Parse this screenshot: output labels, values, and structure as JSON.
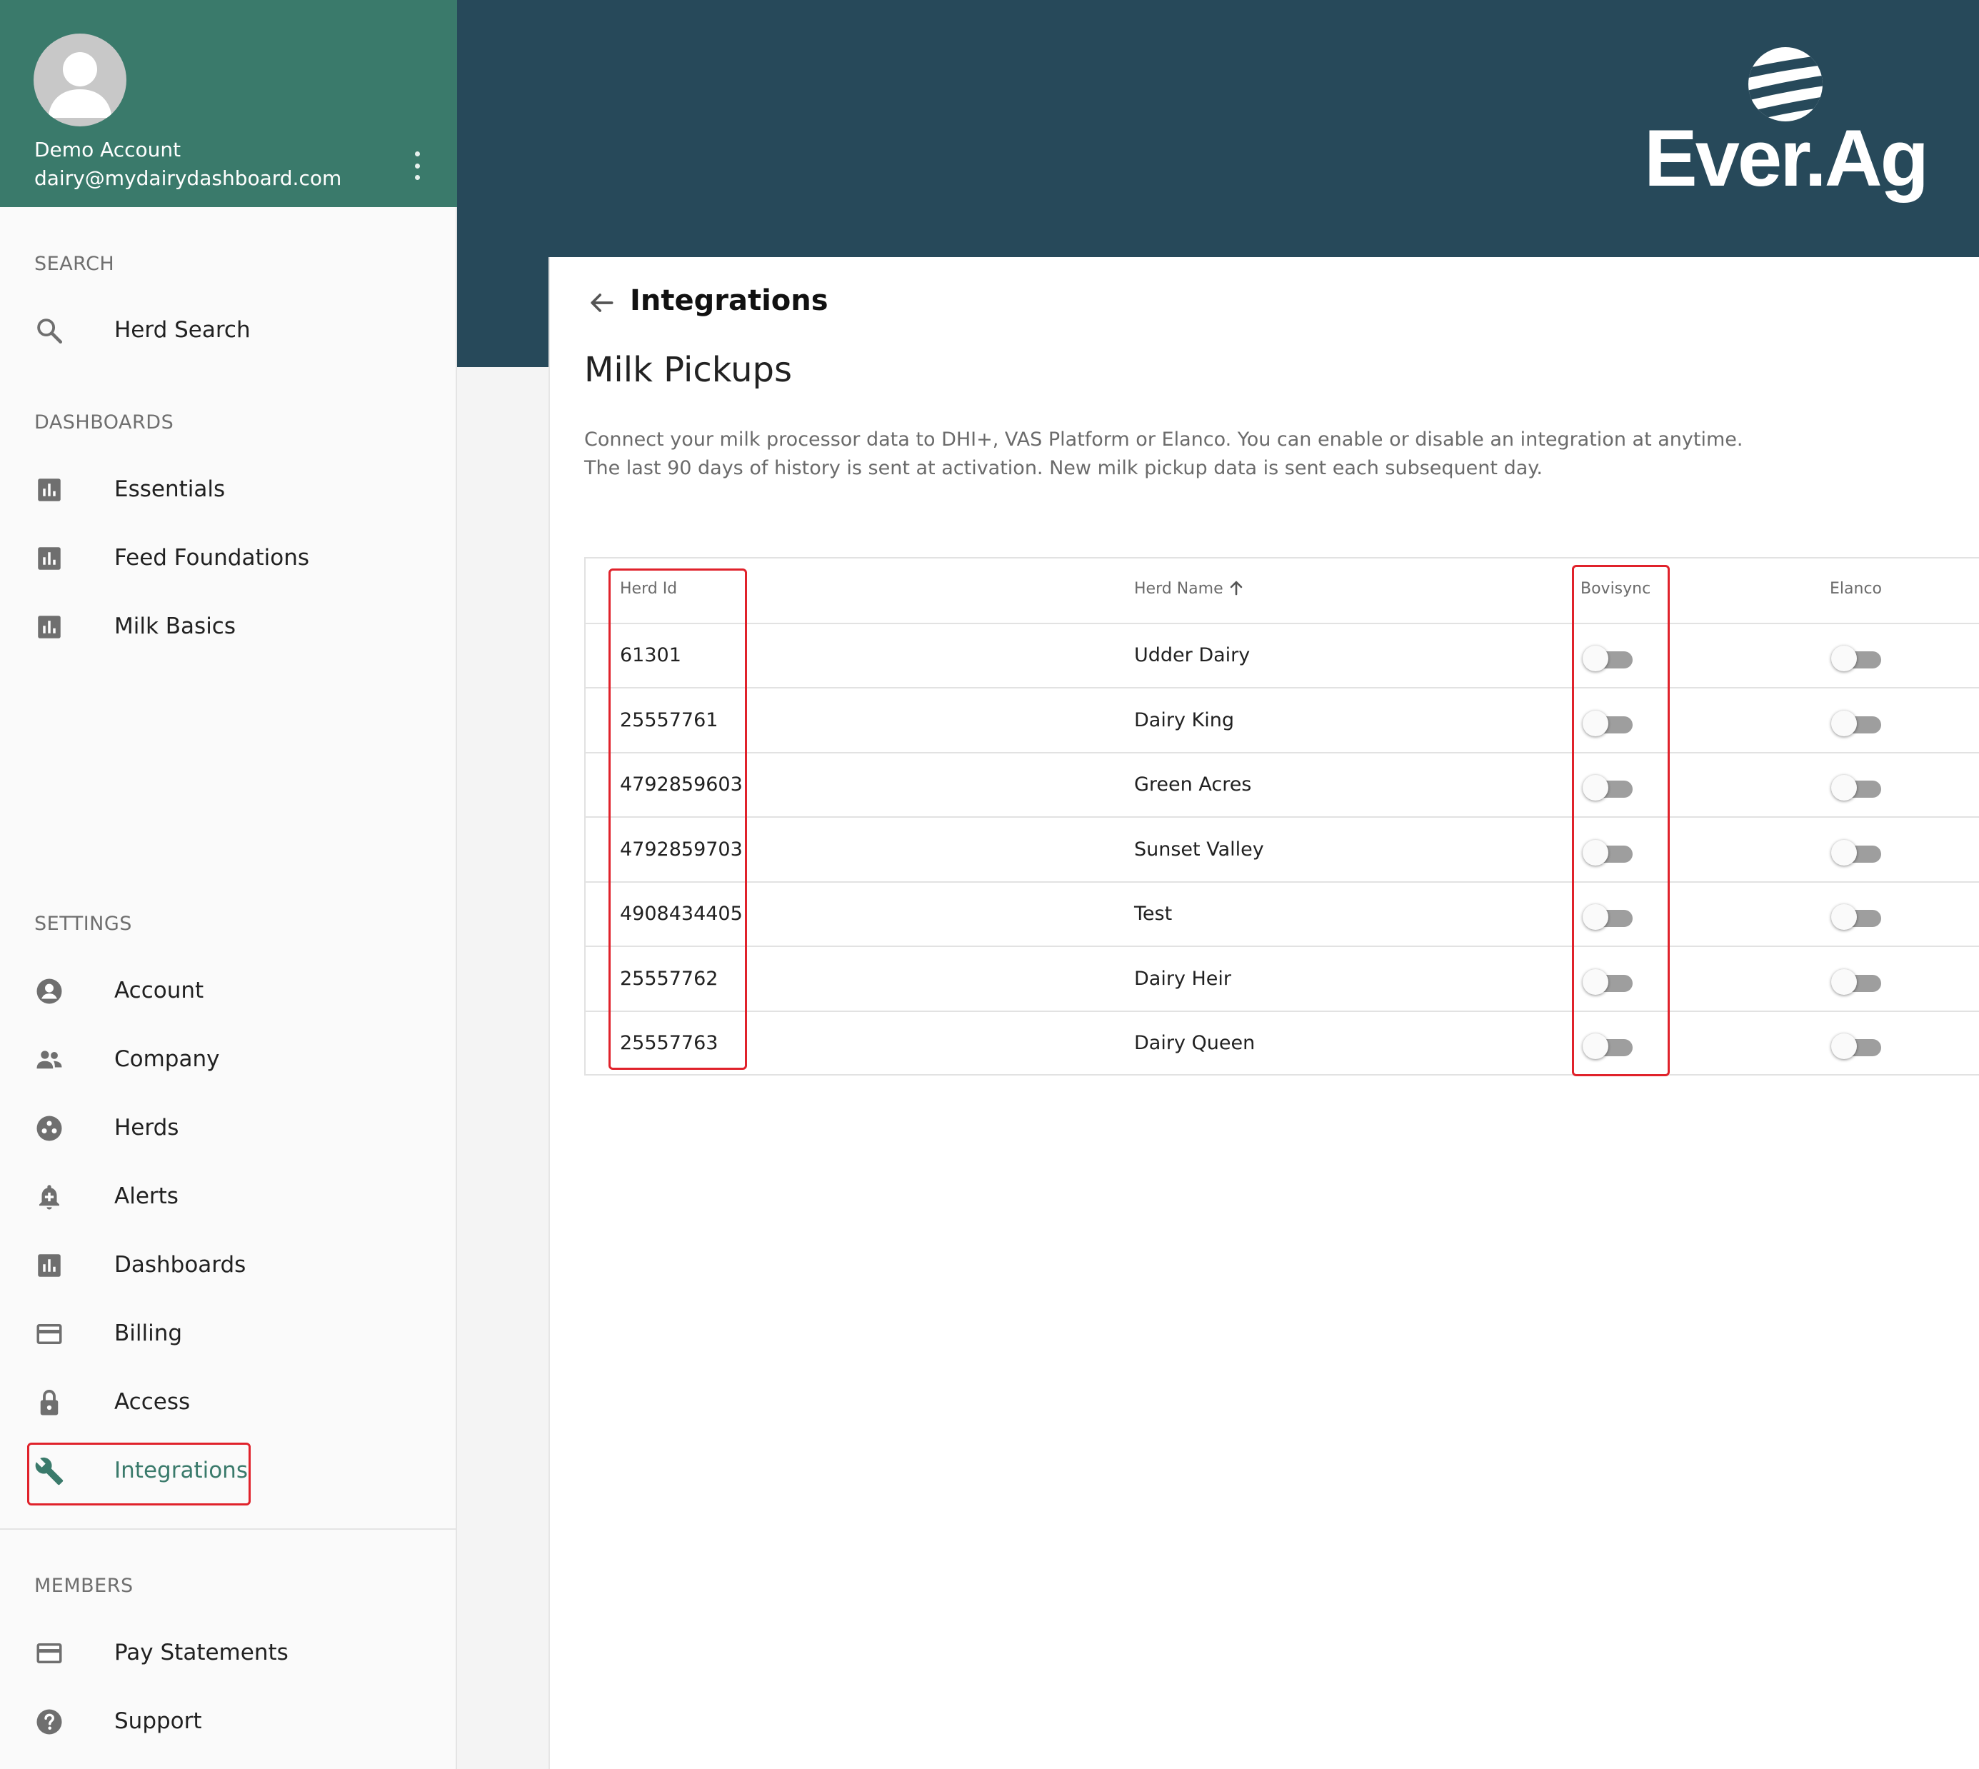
{
  "profile": {
    "name": "Demo Account",
    "email": "dairy@mydairydashboard.com"
  },
  "sidebar": {
    "search": {
      "label": "SEARCH",
      "items": [
        {
          "label": "Herd Search",
          "icon": "search-icon"
        }
      ]
    },
    "dashboards": {
      "label": "DASHBOARDS",
      "items": [
        {
          "label": "Essentials",
          "icon": "bar-chart-icon"
        },
        {
          "label": "Feed Foundations",
          "icon": "bar-chart-icon"
        },
        {
          "label": "Milk Basics",
          "icon": "bar-chart-icon"
        }
      ]
    },
    "settings": {
      "label": "SETTINGS",
      "items": [
        {
          "label": "Account",
          "icon": "account-circle-icon"
        },
        {
          "label": "Company",
          "icon": "people-icon"
        },
        {
          "label": "Herds",
          "icon": "herds-icon"
        },
        {
          "label": "Alerts",
          "icon": "bell-plus-icon"
        },
        {
          "label": "Dashboards",
          "icon": "bar-chart-icon"
        },
        {
          "label": "Billing",
          "icon": "credit-card-icon"
        },
        {
          "label": "Access",
          "icon": "lock-icon"
        },
        {
          "label": "Integrations",
          "icon": "wrench-icon",
          "active": true
        }
      ]
    },
    "members": {
      "label": "MEMBERS",
      "items": [
        {
          "label": "Pay Statements",
          "icon": "credit-card-icon"
        },
        {
          "label": "Support",
          "icon": "help-circle-icon"
        }
      ]
    }
  },
  "header": {
    "logo_text": "Ever.Ag",
    "color": "#27495a"
  },
  "page": {
    "title": "Integrations",
    "section_title": "Milk Pickups",
    "description_line1": "Connect your milk processor data to DHI+, VAS Platform or Elanco. You can enable or disable an integration at anytime.",
    "description_line2": "The last 90 days of history is sent at activation. New milk pickup data is sent each subsequent day."
  },
  "table": {
    "columns": [
      "Herd Id",
      "Herd Name",
      "Bovisync",
      "Elanco"
    ],
    "sorted_column": "Herd Name",
    "sort_direction": "ascending",
    "rows": [
      {
        "herd_id": "61301",
        "herd_name": "Udder Dairy",
        "bovisync": false,
        "elanco": false
      },
      {
        "herd_id": "25557761",
        "herd_name": "Dairy King",
        "bovisync": false,
        "elanco": false
      },
      {
        "herd_id": "4792859603",
        "herd_name": "Green Acres",
        "bovisync": false,
        "elanco": false
      },
      {
        "herd_id": "4792859703",
        "herd_name": "Sunset Valley",
        "bovisync": false,
        "elanco": false
      },
      {
        "herd_id": "4908434405",
        "herd_name": "Test",
        "bovisync": false,
        "elanco": false
      },
      {
        "herd_id": "25557762",
        "herd_name": "Dairy Heir",
        "bovisync": false,
        "elanco": false
      },
      {
        "herd_id": "25557763",
        "herd_name": "Dairy Queen",
        "bovisync": false,
        "elanco": false
      }
    ]
  },
  "colors": {
    "brand_green": "#3a7a6b",
    "header_navy": "#27495a",
    "highlight_red": "#e0222b"
  }
}
